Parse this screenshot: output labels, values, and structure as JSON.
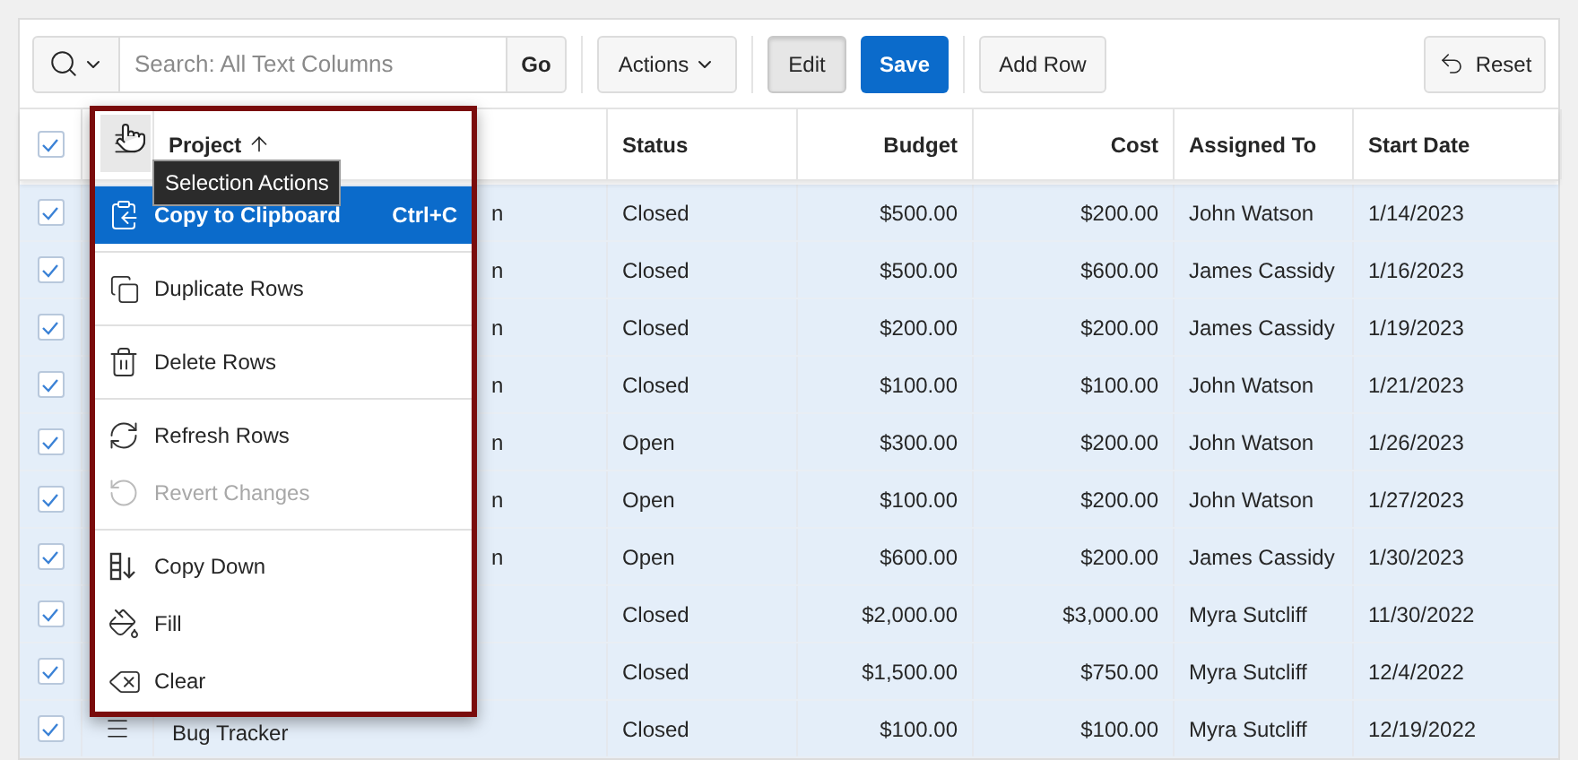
{
  "toolbar": {
    "search": {
      "placeholder": "Search: All Text Columns",
      "go": "Go"
    },
    "actions": "Actions",
    "edit": {
      "label": "Edit",
      "selected": true
    },
    "save": "Save",
    "add_row": "Add Row",
    "reset": "Reset"
  },
  "table": {
    "select_all": {
      "checked": true
    },
    "columns": [
      "Project",
      "Status",
      "Budget",
      "Cost",
      "Assigned To",
      "Start Date"
    ],
    "rows": [
      {
        "checked": true,
        "selected": true,
        "project": "n",
        "cut": true,
        "status": "Closed",
        "budget": "$500.00",
        "cost": "$200.00",
        "assigned": "John Watson",
        "start": "1/14/2023"
      },
      {
        "checked": true,
        "selected": true,
        "project": "n",
        "cut": true,
        "status": "Closed",
        "budget": "$500.00",
        "cost": "$600.00",
        "assigned": "James Cassidy",
        "start": "1/16/2023"
      },
      {
        "checked": true,
        "selected": true,
        "project": "n",
        "cut": true,
        "status": "Closed",
        "budget": "$200.00",
        "cost": "$200.00",
        "assigned": "James Cassidy",
        "start": "1/19/2023"
      },
      {
        "checked": true,
        "selected": true,
        "project": "n",
        "cut": true,
        "status": "Closed",
        "budget": "$100.00",
        "cost": "$100.00",
        "assigned": "John Watson",
        "start": "1/21/2023"
      },
      {
        "checked": true,
        "selected": true,
        "project": "n",
        "cut": true,
        "status": "Open",
        "budget": "$300.00",
        "cost": "$200.00",
        "assigned": "John Watson",
        "start": "1/26/2023"
      },
      {
        "checked": true,
        "selected": true,
        "project": "n",
        "cut": true,
        "status": "Open",
        "budget": "$100.00",
        "cost": "$200.00",
        "assigned": "John Watson",
        "start": "1/27/2023"
      },
      {
        "checked": true,
        "selected": true,
        "project": "n",
        "cut": true,
        "status": "Open",
        "budget": "$600.00",
        "cost": "$200.00",
        "assigned": "James Cassidy",
        "start": "1/30/2023"
      },
      {
        "checked": true,
        "selected": true,
        "status": "Closed",
        "budget": "$2,000.00",
        "cost": "$3,000.00",
        "assigned": "Myra Sutcliff",
        "start": "11/30/2022"
      },
      {
        "checked": true,
        "selected": true,
        "status": "Closed",
        "budget": "$1,500.00",
        "cost": "$750.00",
        "assigned": "Myra Sutcliff",
        "start": "12/4/2022"
      },
      {
        "checked": true,
        "selected": true,
        "project": "Bug Tracker",
        "cut": false,
        "status": "Closed",
        "budget": "$100.00",
        "cost": "$100.00",
        "assigned": "Myra Sutcliff",
        "start": "12/19/2022"
      }
    ]
  },
  "tooltip": "Selection Actions",
  "menu": {
    "groups": [
      {
        "items": [
          {
            "label": "Copy to Clipboard",
            "shortcut": "Ctrl+C",
            "selected": true,
            "disabled": false
          }
        ]
      },
      {
        "items": [
          {
            "label": "Duplicate Rows",
            "selected": false,
            "disabled": false
          }
        ]
      },
      {
        "items": [
          {
            "label": "Delete Rows",
            "selected": false,
            "disabled": false
          }
        ]
      },
      {
        "items": [
          {
            "label": "Refresh Rows",
            "selected": false,
            "disabled": false
          },
          {
            "label": "Revert Changes",
            "selected": false,
            "disabled": true
          }
        ]
      },
      {
        "items": [
          {
            "label": "Copy Down",
            "selected": false,
            "disabled": false
          },
          {
            "label": "Fill",
            "selected": false,
            "disabled": false
          },
          {
            "label": "Clear",
            "selected": false,
            "disabled": false
          }
        ]
      }
    ]
  }
}
